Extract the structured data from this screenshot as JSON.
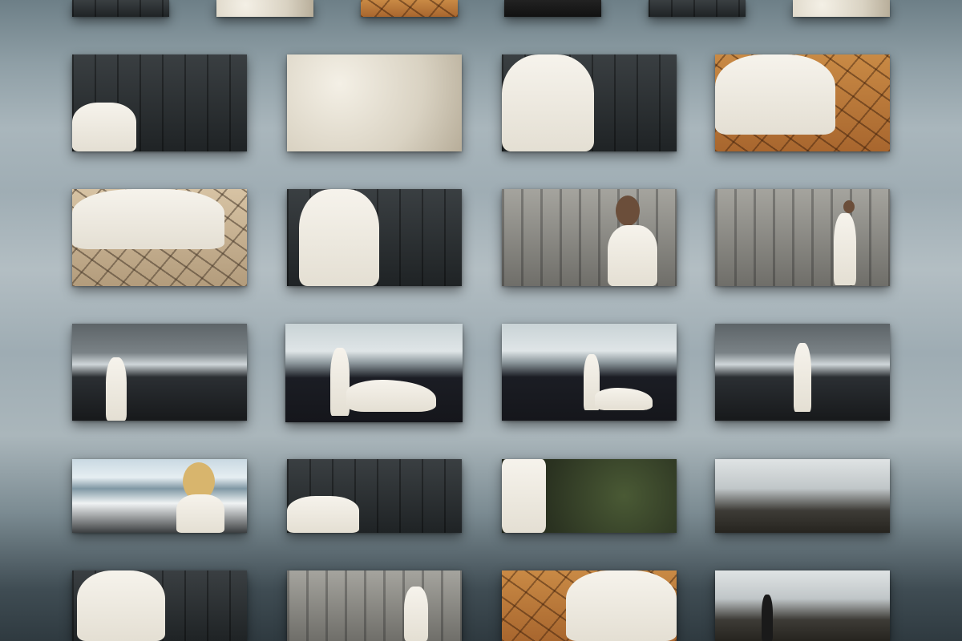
{
  "gallery": {
    "rows": [
      {
        "tiles": [
          {
            "caption": "",
            "scene": "basalt"
          },
          {
            "caption": "",
            "scene": "lace"
          },
          {
            "caption": "",
            "scene": "mud"
          },
          {
            "caption": "",
            "scene": "black-sand"
          },
          {
            "caption": "",
            "scene": "basalt"
          },
          {
            "caption": "",
            "scene": "lace"
          }
        ]
      },
      {
        "tiles": [
          {
            "caption": "",
            "scene": "basalt"
          },
          {
            "caption": "",
            "scene": "lace"
          },
          {
            "caption": "",
            "scene": "basalt"
          },
          {
            "caption": "",
            "scene": "mud"
          }
        ]
      },
      {
        "tiles": [
          {
            "caption": "",
            "scene": "pale-mud"
          },
          {
            "caption": "",
            "scene": "basalt"
          },
          {
            "caption": "",
            "scene": "stone-grey"
          },
          {
            "caption": "",
            "scene": "stone-grey"
          }
        ]
      },
      {
        "tiles": [
          {
            "caption": "",
            "scene": "beach-dark"
          },
          {
            "caption": "",
            "scene": "beach-bright"
          },
          {
            "caption": "",
            "scene": "beach-bright"
          },
          {
            "caption": "",
            "scene": "beach-dark"
          }
        ]
      },
      {
        "tiles": [
          {
            "caption": "",
            "scene": "beach-sunny"
          },
          {
            "caption": "",
            "scene": "basalt"
          },
          {
            "caption": "",
            "scene": "moss"
          },
          {
            "caption": "",
            "scene": "wreck"
          }
        ]
      },
      {
        "tiles": [
          {
            "caption": "",
            "scene": "basalt"
          },
          {
            "caption": "",
            "scene": "stone-grey"
          },
          {
            "caption": "",
            "scene": "mud"
          },
          {
            "caption": "",
            "scene": "wreck"
          }
        ]
      }
    ]
  }
}
